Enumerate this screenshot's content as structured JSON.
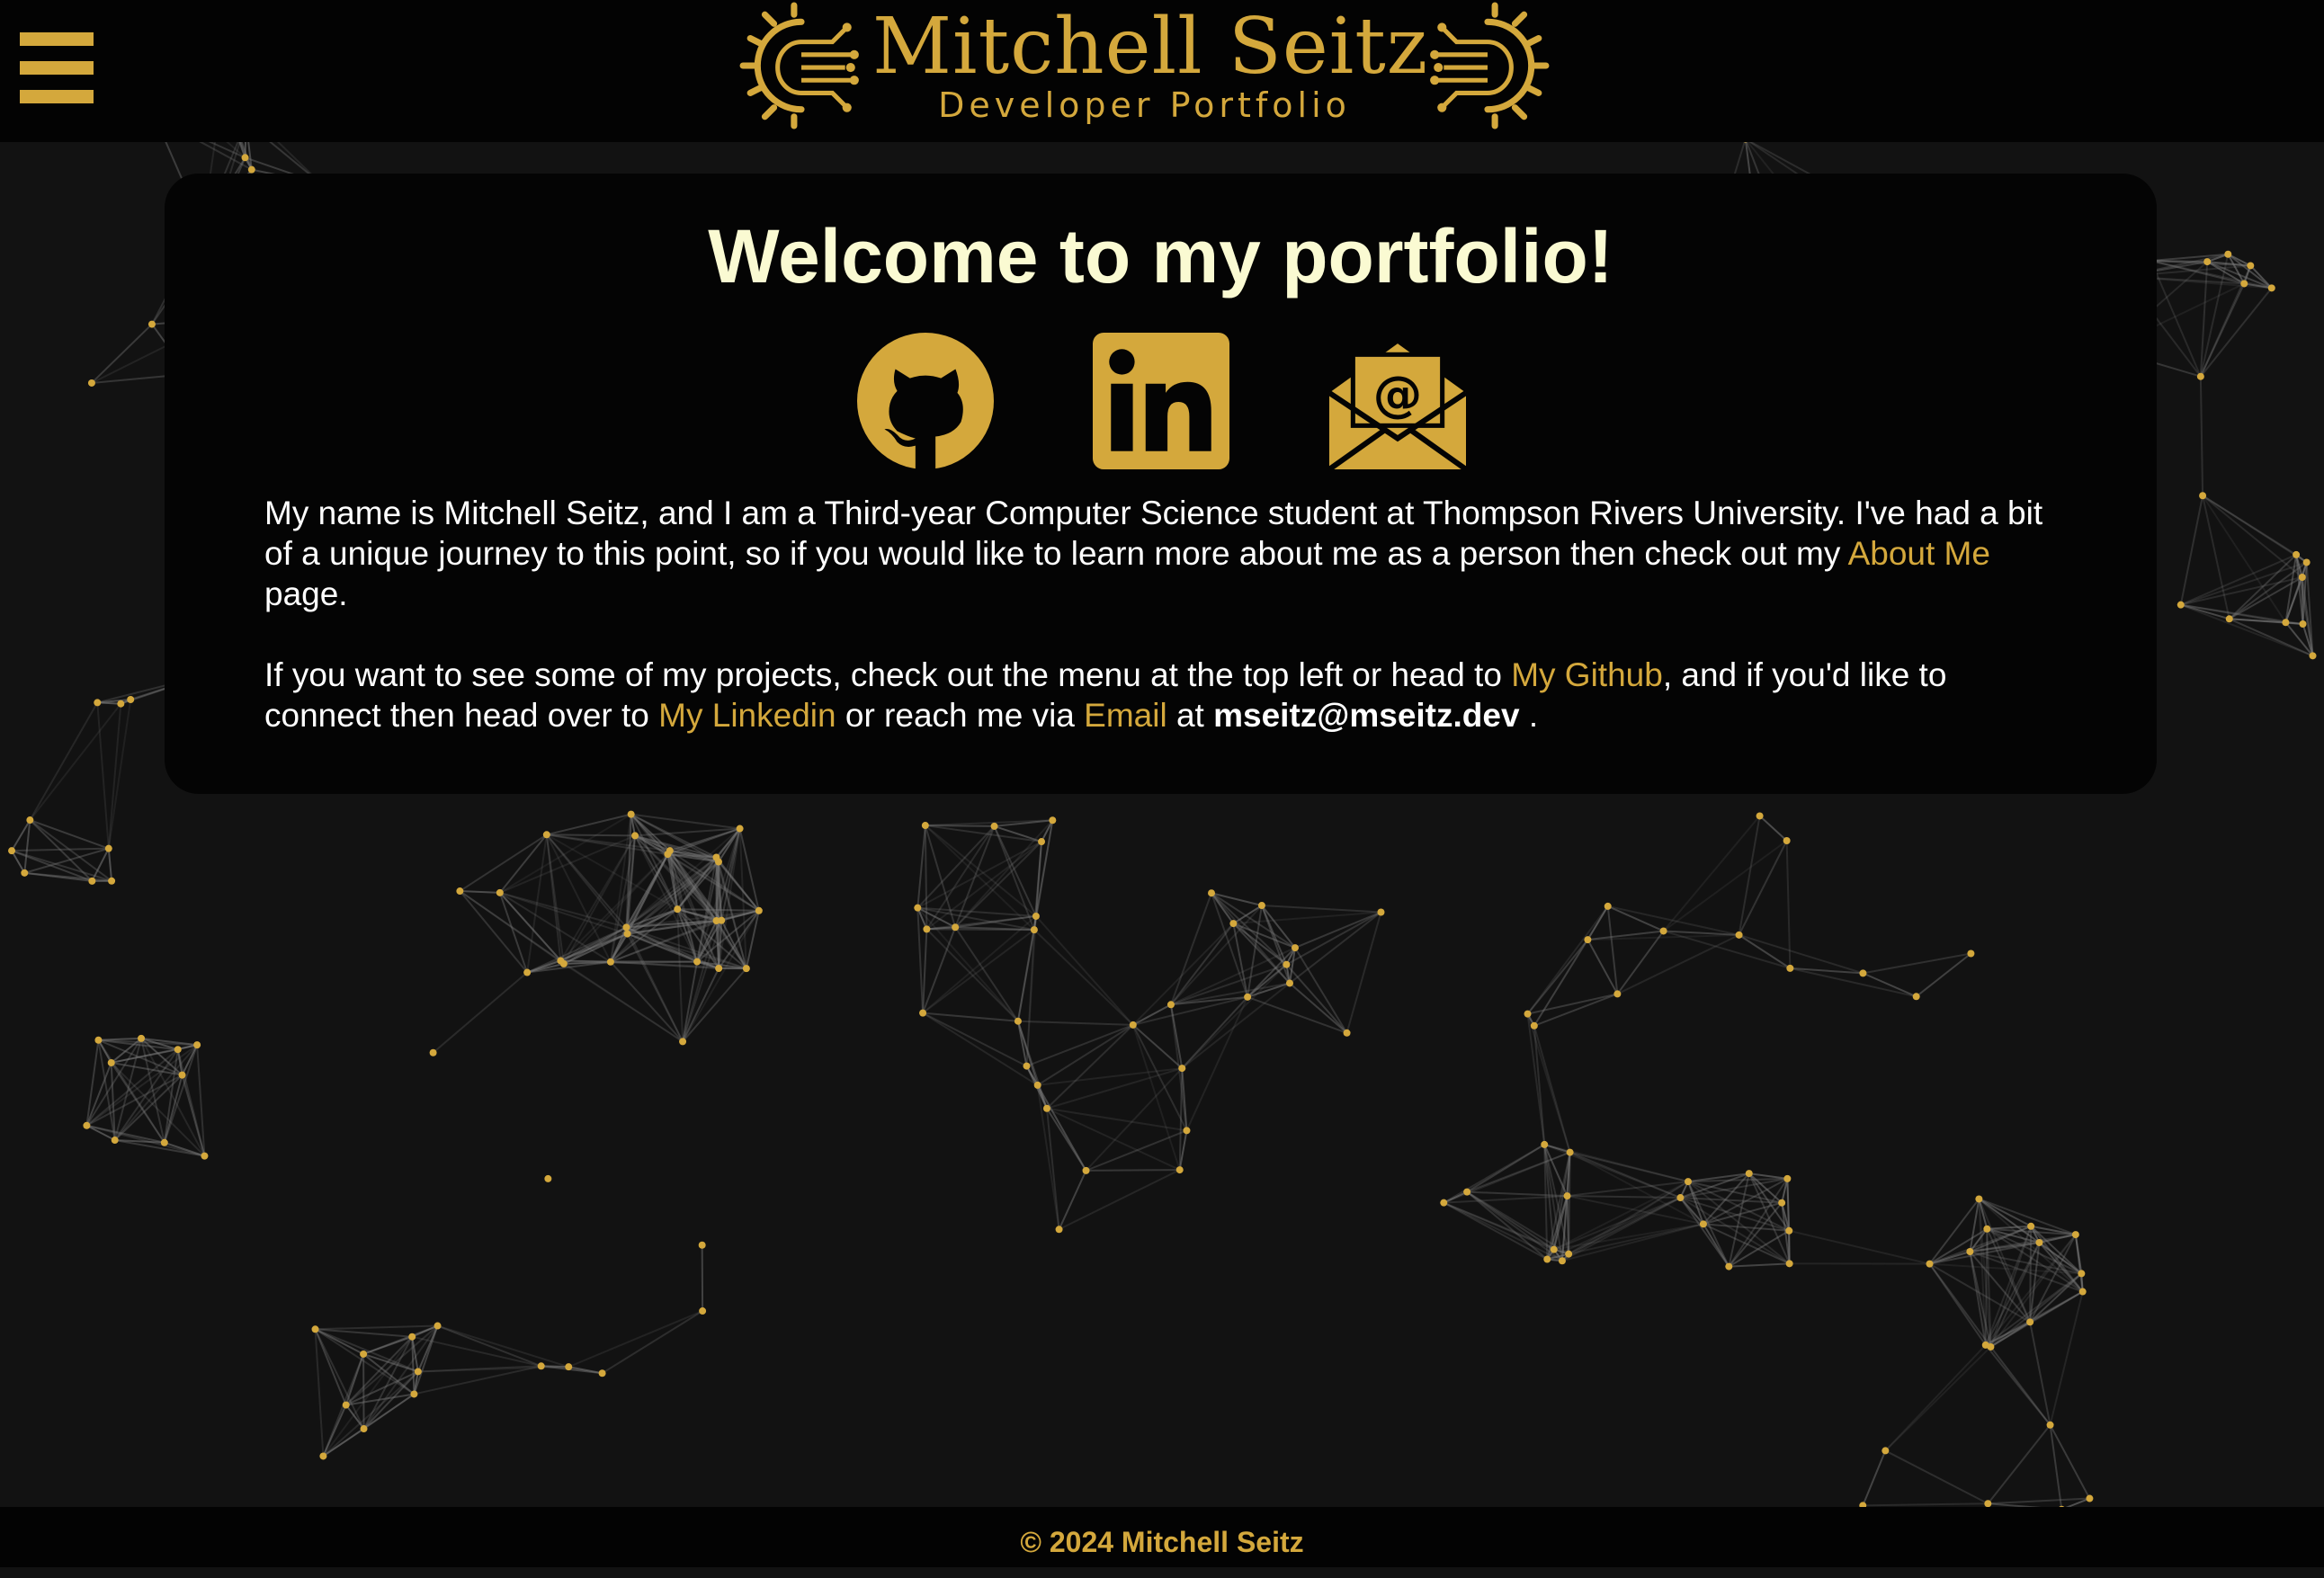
{
  "header": {
    "logo_title": "Mitchell Seitz",
    "logo_subtitle": "Developer Portfolio",
    "menu_icon": "hamburger-menu-icon"
  },
  "main": {
    "welcome": "Welcome to my portfolio!",
    "social": [
      {
        "name": "github",
        "icon": "github-icon"
      },
      {
        "name": "linkedin",
        "icon": "linkedin-icon"
      },
      {
        "name": "email",
        "icon": "envelope-at-icon"
      }
    ],
    "p1": {
      "text": "My name is Mitchell Seitz, and I am a Third-year Computer Science student at Thompson Rivers University. I've had a bit of a unique journey to this point, so if you would like to learn more about me as a person then check out my ",
      "about_link": "About Me",
      "end": " page."
    },
    "p2": {
      "text": "If you want to see some of my projects, check out the menu at the top left or head to ",
      "github_link": "My Github",
      "mid1": ", and if you'd like to connect then head over to ",
      "linkedin_link": "My Linkedin",
      "mid2": " or reach me via ",
      "email_link": "Email",
      "mid3": " at ",
      "email_address": "mseitz@mseitz.dev",
      "end": " ."
    }
  },
  "footer": {
    "copyright": "© 2024 Mitchell Seitz"
  },
  "colors": {
    "accent": "#d4a83c",
    "background": "#121212",
    "panel": "#040404",
    "heading": "#fafad2",
    "text": "#ffffff"
  }
}
